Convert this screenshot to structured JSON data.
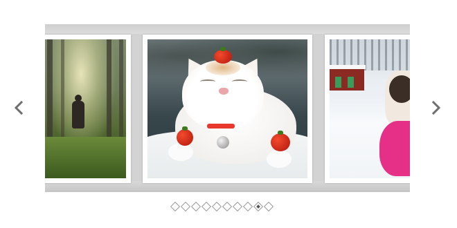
{
  "slider": {
    "slides": [
      {
        "icon": "forest-photo"
      },
      {
        "icon": "cat-with-tomatoes-photo"
      },
      {
        "icon": "snow-cat-photo"
      }
    ],
    "active_index": 8,
    "dot_count": 10
  },
  "controls": {
    "prev_icon": "chevron-left-icon",
    "next_icon": "chevron-right-icon"
  },
  "colors": {
    "frame": "#d3d3d3",
    "arrow": "#6e6e6e",
    "dot_border": "#9a9a9a"
  }
}
